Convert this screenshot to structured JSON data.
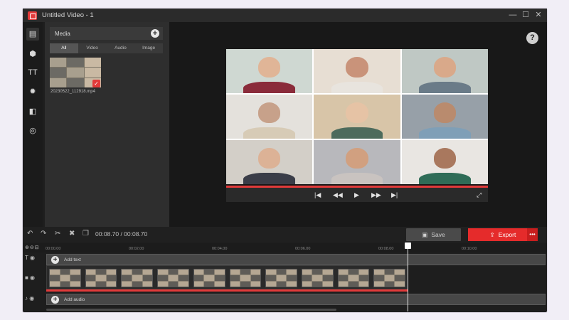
{
  "window": {
    "title": "Untitled Video - 1",
    "minimize_icon": "—",
    "maximize_icon": "☐",
    "close_icon": "✕"
  },
  "colors": {
    "accent": "#e23a3a",
    "export": "#e52b2b",
    "panel": "#2e2e2e",
    "background": "#1e1e1e"
  },
  "tools": [
    {
      "name": "media-tool",
      "glyph": "▤"
    },
    {
      "name": "sticker-tool",
      "glyph": "⬢"
    },
    {
      "name": "text-tool",
      "glyph": "TT"
    },
    {
      "name": "effects-tool",
      "glyph": "✹"
    },
    {
      "name": "transition-tool",
      "glyph": "◧"
    },
    {
      "name": "filter-tool",
      "glyph": "◎"
    }
  ],
  "media": {
    "title": "Media",
    "add_icon": "+",
    "tabs": [
      "All",
      "Video",
      "Audio",
      "Image"
    ],
    "active_tab": "All",
    "file": {
      "name": "20230522_112918.mp4",
      "check": "✓"
    }
  },
  "help_label": "?",
  "player": {
    "prev_frame": "|◀",
    "rewind": "◀◀",
    "play": "▶",
    "forward": "▶▶",
    "next_frame": "▶|",
    "fullscreen": "⤢"
  },
  "timeline_toolbar": {
    "timecode": "00:08.70 / 00:08.70",
    "undo": "↶",
    "redo": "↷",
    "cut": "✂",
    "delete": "✖",
    "copy": "❐",
    "save_label": "Save",
    "save_icon": "▣",
    "export_label": "Export",
    "export_icon": "⇪",
    "more": "•••"
  },
  "ruler": {
    "zoom": "⊕⊖⊟",
    "ticks": [
      "00:00.00",
      "00:02.00",
      "00:04.00",
      "00:06.00",
      "00:08.00",
      "00:10.00"
    ]
  },
  "tracks": {
    "text_label": "Add text",
    "audio_label": "Add audio",
    "text_head": "T ◉",
    "video_head": "■ ◉",
    "audio_head": "♪ ◉",
    "clip_count": 10
  }
}
